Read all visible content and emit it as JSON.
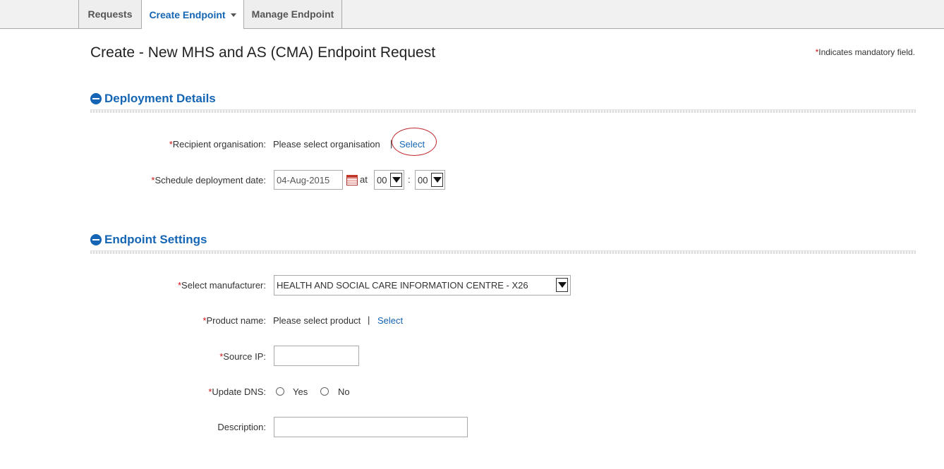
{
  "nav": {
    "tabs": [
      {
        "label": "Requests"
      },
      {
        "label": "Create Endpoint"
      },
      {
        "label": "Manage Endpoint"
      }
    ]
  },
  "page": {
    "title": "Create - New MHS and AS (CMA) Endpoint Request",
    "mandatory_marker": "*",
    "mandatory_note": "Indicates mandatory field."
  },
  "deployment": {
    "header": "Deployment Details",
    "recipient_label": "Recipient organisation:",
    "recipient_value": "Please select organisation",
    "recipient_separator": "|",
    "recipient_select": "Select",
    "schedule_label": "Schedule deployment date:",
    "schedule_date": "04-Aug-2015",
    "at_label": "at",
    "hour": "00",
    "time_separator": ":",
    "minute": "00"
  },
  "endpoint": {
    "header": "Endpoint Settings",
    "manufacturer_label": "Select manufacturer:",
    "manufacturer_value": "HEALTH AND SOCIAL CARE INFORMATION CENTRE - X26",
    "product_label": "Product name:",
    "product_value": "Please select product",
    "product_separator": "|",
    "product_select": "Select",
    "source_ip_label": "Source IP:",
    "source_ip_value": "",
    "update_dns_label": "Update DNS:",
    "dns_yes": "Yes",
    "dns_no": "No",
    "description_label": "Description:",
    "description_value": ""
  },
  "colors": {
    "accent": "#1565b5",
    "required": "#cc1111",
    "highlight": "#c0282d"
  },
  "icons": [
    "minus-circle-icon",
    "calendar-icon",
    "chevron-down-icon",
    "caret-down-icon"
  ]
}
